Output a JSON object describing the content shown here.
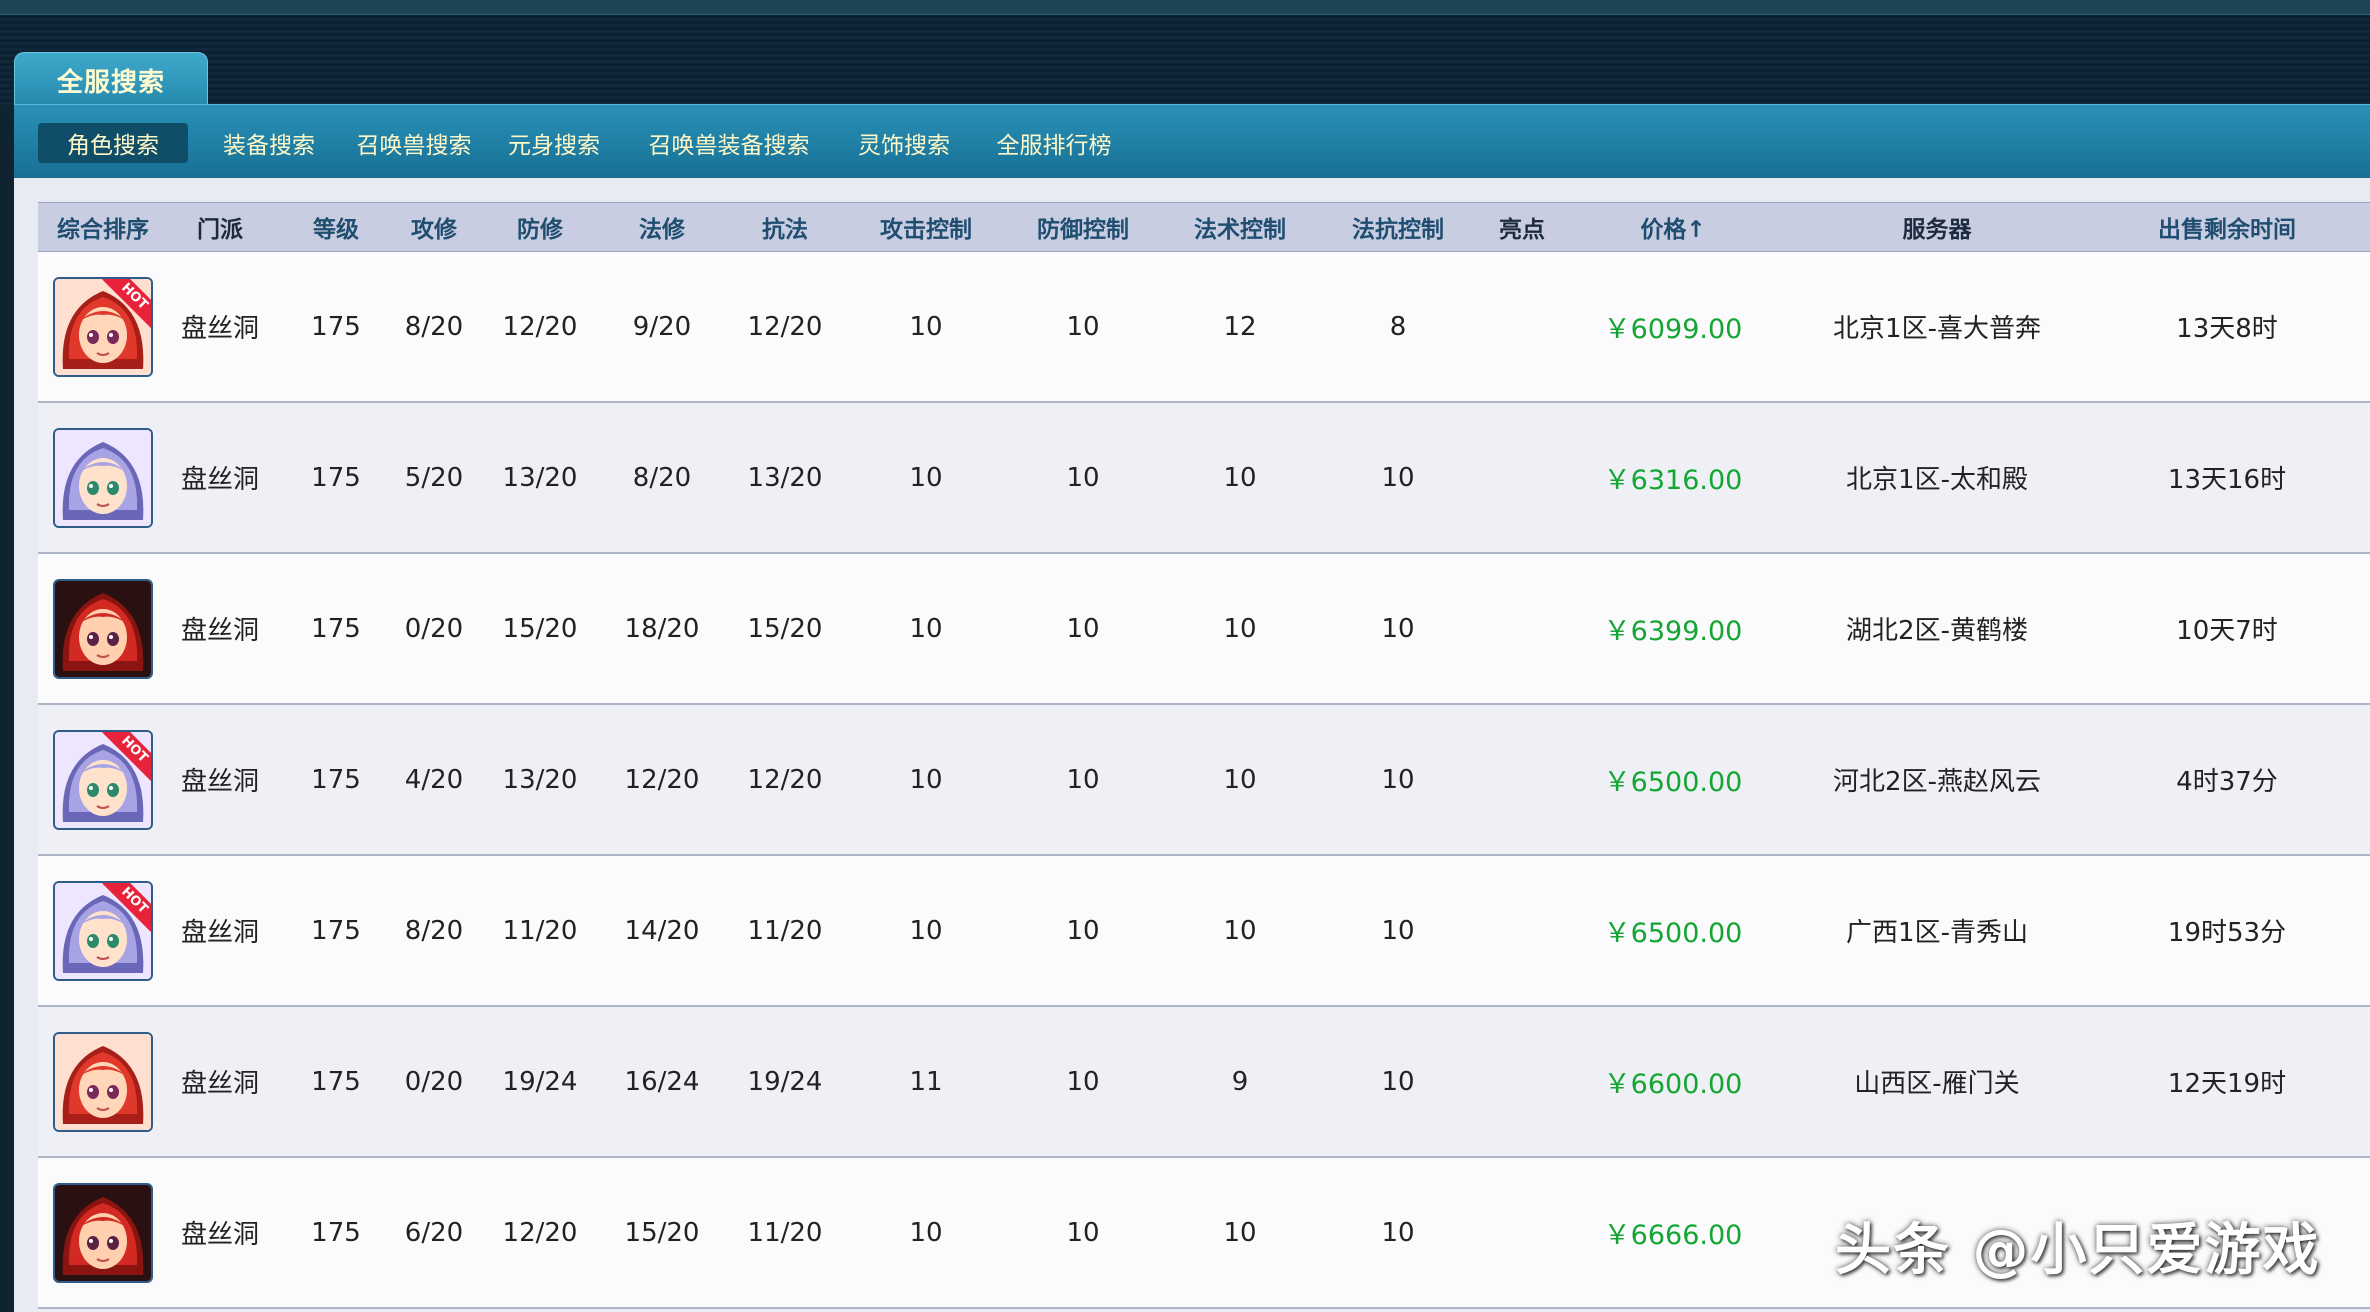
{
  "header": {
    "main_tab": "全服搜索"
  },
  "subnav": {
    "items": [
      {
        "label": "角色搜索",
        "active": true
      },
      {
        "label": "装备搜索"
      },
      {
        "label": "召唤兽搜索"
      },
      {
        "label": "元身搜索"
      },
      {
        "label": "召唤兽装备搜索"
      },
      {
        "label": "灵饰搜索"
      },
      {
        "label": "全服排行榜"
      }
    ]
  },
  "table": {
    "columns": [
      "综合排序",
      "门派",
      "等级",
      "攻修",
      "防修",
      "法修",
      "抗法",
      "攻击控制",
      "防御控制",
      "法术控制",
      "法抗控制",
      "亮点",
      "价格↑",
      "服务器",
      "出售剩余时间"
    ],
    "rows": [
      {
        "avatar": "red-hair",
        "hot": true,
        "hot_label": "HOT",
        "sect": "盘丝洞",
        "level": "175",
        "atk": "8/20",
        "def": "12/20",
        "mag": "9/20",
        "res": "12/20",
        "atk_ctrl": "10",
        "def_ctrl": "10",
        "mag_ctrl": "12",
        "res_ctrl": "8",
        "highlight": "",
        "price": "￥6099.00",
        "server": "北京1区-喜大普奔",
        "time": "13天8时"
      },
      {
        "avatar": "silver-hair",
        "hot": false,
        "sect": "盘丝洞",
        "level": "175",
        "atk": "5/20",
        "def": "13/20",
        "mag": "8/20",
        "res": "13/20",
        "atk_ctrl": "10",
        "def_ctrl": "10",
        "mag_ctrl": "10",
        "res_ctrl": "10",
        "highlight": "",
        "price": "￥6316.00",
        "server": "北京1区-太和殿",
        "time": "13天16时"
      },
      {
        "avatar": "red-hair-dark",
        "hot": false,
        "sect": "盘丝洞",
        "level": "175",
        "atk": "0/20",
        "def": "15/20",
        "mag": "18/20",
        "res": "15/20",
        "atk_ctrl": "10",
        "def_ctrl": "10",
        "mag_ctrl": "10",
        "res_ctrl": "10",
        "highlight": "",
        "price": "￥6399.00",
        "server": "湖北2区-黄鹤楼",
        "time": "10天7时"
      },
      {
        "avatar": "silver-hair",
        "hot": true,
        "hot_label": "HOT",
        "sect": "盘丝洞",
        "level": "175",
        "atk": "4/20",
        "def": "13/20",
        "mag": "12/20",
        "res": "12/20",
        "atk_ctrl": "10",
        "def_ctrl": "10",
        "mag_ctrl": "10",
        "res_ctrl": "10",
        "highlight": "",
        "price": "￥6500.00",
        "server": "河北2区-燕赵风云",
        "time": "4时37分"
      },
      {
        "avatar": "silver-hair",
        "hot": true,
        "hot_label": "HOT",
        "sect": "盘丝洞",
        "level": "175",
        "atk": "8/20",
        "def": "11/20",
        "mag": "14/20",
        "res": "11/20",
        "atk_ctrl": "10",
        "def_ctrl": "10",
        "mag_ctrl": "10",
        "res_ctrl": "10",
        "highlight": "",
        "price": "￥6500.00",
        "server": "广西1区-青秀山",
        "time": "19时53分"
      },
      {
        "avatar": "red-hair",
        "hot": false,
        "sect": "盘丝洞",
        "level": "175",
        "atk": "0/20",
        "def": "19/24",
        "mag": "16/24",
        "res": "19/24",
        "atk_ctrl": "11",
        "def_ctrl": "10",
        "mag_ctrl": "9",
        "res_ctrl": "10",
        "highlight": "",
        "price": "￥6600.00",
        "server": "山西区-雁门关",
        "time": "12天19时"
      },
      {
        "avatar": "red-hair-dark",
        "hot": false,
        "sect": "盘丝洞",
        "level": "175",
        "atk": "6/20",
        "def": "12/20",
        "mag": "15/20",
        "res": "11/20",
        "atk_ctrl": "10",
        "def_ctrl": "10",
        "mag_ctrl": "10",
        "res_ctrl": "10",
        "highlight": "",
        "price": "￥6666.00",
        "server": "",
        "time": ""
      }
    ]
  },
  "watermark": "头条 @小只爱游戏",
  "colors": {
    "price": "#14a532",
    "header_bg": "#c9cde2",
    "nav_bg": "#2a91b8",
    "nav_text": "#fff8c8"
  }
}
